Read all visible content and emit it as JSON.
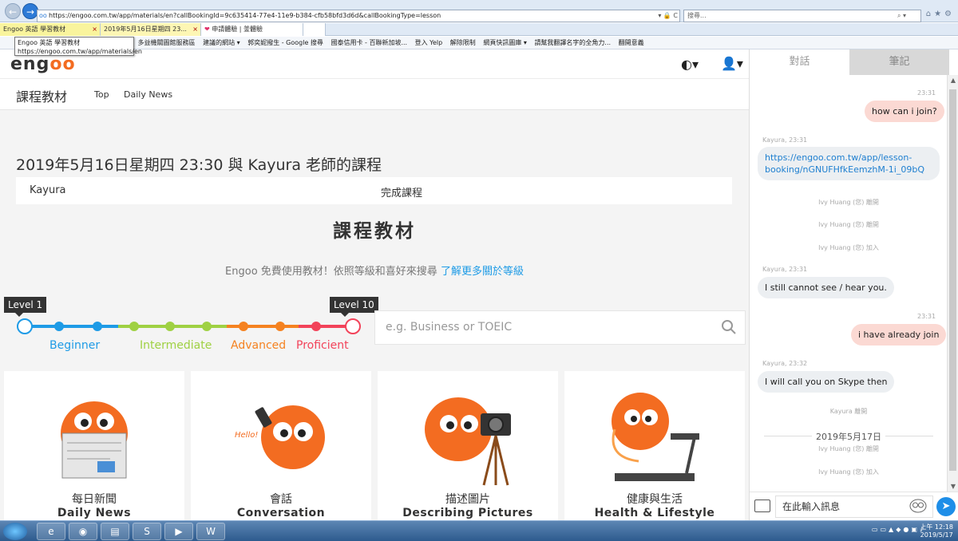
{
  "browser": {
    "url": "https://engoo.com.tw/app/materials/en?callBookingId=9c635414-77e4-11e9-b384-cfb58bfd3d6d&callBookingType=lesson",
    "search_placeholder": "搜尋...",
    "tabs": [
      {
        "label": "Engoo 英語 學習教材"
      },
      {
        "label": "2019年5月16日星期四 23..."
      },
      {
        "label": "申請體驗 | 釜體驗"
      }
    ],
    "tooltip_line1": "Engoo 英語 學習教材",
    "tooltip_line2": "https://engoo.com.tw/app/materials/en",
    "favorites": [
      "建議的網站 ▾",
      "多益機關圖館服務區",
      "建議的網站 ▾",
      "郭奕妮撥生 - Google 搜尋",
      "國泰信用卡 - 百聯新加坡...",
      "登入 Yelp",
      "解除限制",
      "網頁快訊圖庫 ▾",
      "請幫我翻譯名字的全角力...",
      "翻開意義"
    ]
  },
  "header": {
    "logo_text_a": "eng",
    "logo_text_b": "oo"
  },
  "subnav": {
    "title": "課程教材",
    "link_top": "Top",
    "link_news": "Daily News"
  },
  "lesson": {
    "title": "2019年5月16日星期四 23:30 與 Kayura 老師的課程",
    "teacher": "Kayura",
    "status": "完成課程"
  },
  "materials": {
    "title": "課程教材",
    "desc": "Engoo 免費使用教材！依照等級和喜好來搜尋",
    "desc_link": "了解更多關於等級",
    "level_min": "Level 1",
    "level_max": "Level 10",
    "levels": [
      {
        "label": "Beginner",
        "color": "#1e9be6"
      },
      {
        "label": "Intermediate",
        "color": "#9fd143"
      },
      {
        "label": "Advanced",
        "color": "#f58220"
      },
      {
        "label": "Proficient",
        "color": "#f2435a"
      }
    ],
    "search_placeholder": "e.g. Business or TOEIC"
  },
  "cards": [
    {
      "zh": "每日新聞",
      "en": "Daily News",
      "icon": "newspaper-owl-icon"
    },
    {
      "zh": "會話",
      "en": "Conversation",
      "icon": "phone-owl-icon",
      "bubble": "Hello!"
    },
    {
      "zh": "描述圖片",
      "en": "Describing Pictures",
      "icon": "camera-owl-icon"
    },
    {
      "zh": "健康與生活",
      "en": "Health & Lifestyle",
      "icon": "treadmill-owl-icon"
    }
  ],
  "chat": {
    "tab_chat": "對話",
    "tab_notes": "筆記",
    "messages": [
      {
        "time": "23:31"
      },
      {
        "text": "how can i join?"
      },
      {
        "time": "Kayura, 23:31"
      },
      {
        "text_a": "https://engoo.com.tw/app/lesson-",
        "text_b": "booking/nGNUFHfkEemzhM-1i_09bQ"
      },
      {
        "text": "Ivy Huang (您) 離開"
      },
      {
        "text": "Ivy Huang (您) 離開"
      },
      {
        "text": "Ivy Huang (您) 加入"
      },
      {
        "time": "Kayura, 23:31"
      },
      {
        "text": "I still cannot see / hear you."
      },
      {
        "time": "23:31"
      },
      {
        "text": "i have already join"
      },
      {
        "time": "Kayura, 23:32"
      },
      {
        "text": "I will call you on Skype then"
      },
      {
        "text": "Kayura 離開"
      },
      {
        "text": "2019年5月17日"
      },
      {
        "text": "Ivy Huang (您) 離開"
      },
      {
        "text": "Ivy Huang (您) 加入"
      }
    ],
    "input_value": "在此輸入訊息"
  },
  "taskbar": {
    "clock_time": "上午 12:18",
    "clock_date": "2019/5/17"
  }
}
